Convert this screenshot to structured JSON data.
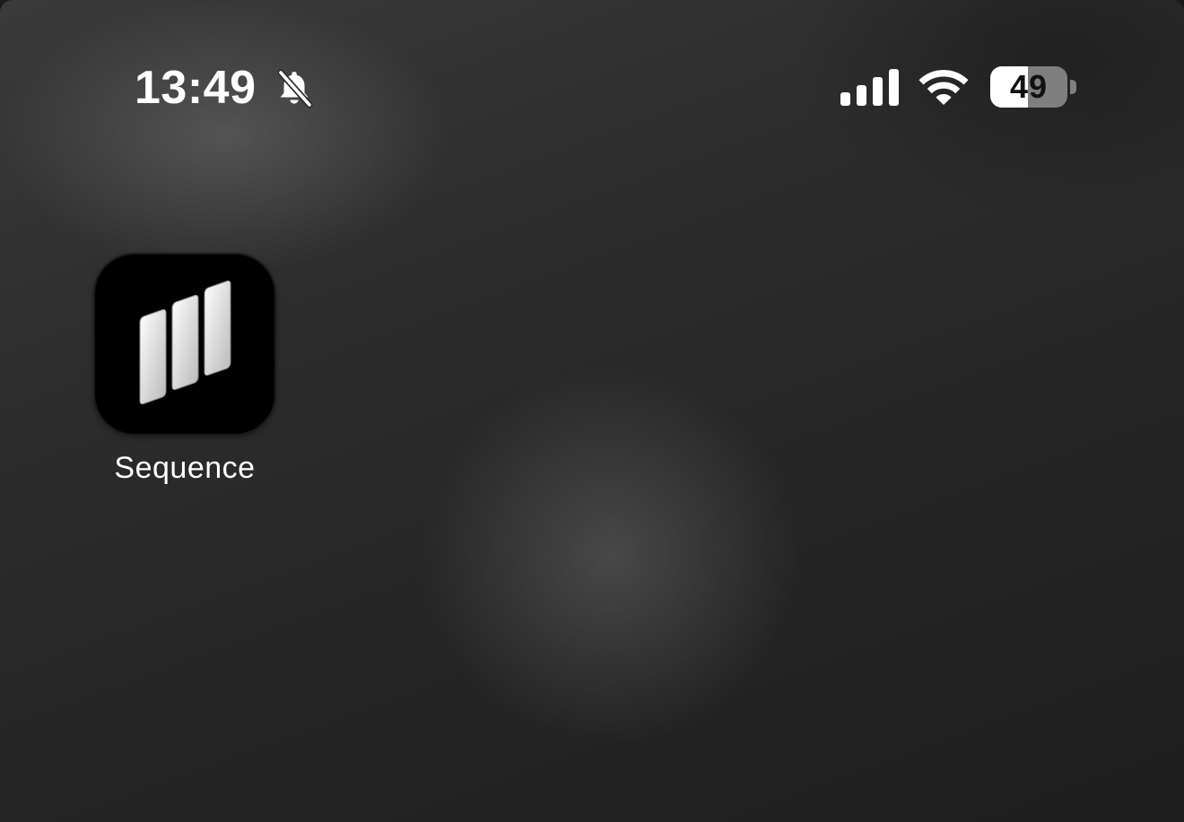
{
  "status_bar": {
    "time": "13:49",
    "silent_icon": "bell-slash-icon",
    "signal_icon": "cellular-signal-icon",
    "wifi_icon": "wifi-icon",
    "battery": {
      "level": 49,
      "label": "49",
      "icon": "battery-icon"
    }
  },
  "home_screen": {
    "apps": [
      {
        "label": "Sequence",
        "icon": "sequence-app-icon",
        "icon_background": "#000000"
      }
    ]
  }
}
